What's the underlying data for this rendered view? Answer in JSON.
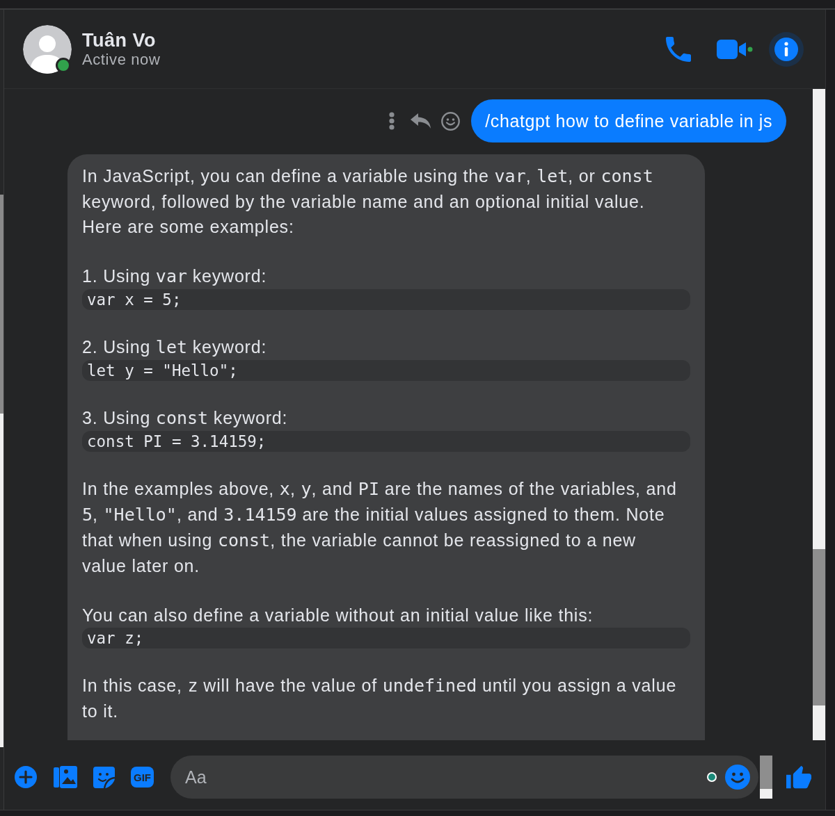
{
  "contact": {
    "name": "Tuân Vo",
    "status": "Active now",
    "online": true
  },
  "messages": [
    {
      "kind": "sent",
      "text": "/chatgpt how to define variable in js"
    },
    {
      "kind": "received",
      "blocks": [
        {
          "kind": "paragraph",
          "parts": [
            {
              "kind": "plain",
              "text": "In JavaScript, you can define a variable using the "
            },
            {
              "kind": "code",
              "text": "var"
            },
            {
              "kind": "plain",
              "text": ", "
            },
            {
              "kind": "code",
              "text": "let"
            },
            {
              "kind": "plain",
              "text": ", or "
            },
            {
              "kind": "code",
              "text": "const"
            },
            {
              "kind": "plain",
              "text": " keyword, followed by the variable name and an optional initial value. Here are some examples:"
            }
          ]
        },
        {
          "kind": "paragraph",
          "parts": [
            {
              "kind": "plain",
              "text": "1. Using "
            },
            {
              "kind": "code",
              "text": "var"
            },
            {
              "kind": "plain",
              "text": " keyword:"
            }
          ]
        },
        {
          "kind": "code_block",
          "text": "var x = 5;"
        },
        {
          "kind": "paragraph",
          "parts": [
            {
              "kind": "plain",
              "text": "2. Using "
            },
            {
              "kind": "code",
              "text": "let"
            },
            {
              "kind": "plain",
              "text": " keyword:"
            }
          ]
        },
        {
          "kind": "code_block",
          "text": "let y = \"Hello\";"
        },
        {
          "kind": "paragraph",
          "parts": [
            {
              "kind": "plain",
              "text": "3. Using "
            },
            {
              "kind": "code",
              "text": "const"
            },
            {
              "kind": "plain",
              "text": " keyword:"
            }
          ]
        },
        {
          "kind": "code_block",
          "text": "const PI = 3.14159;"
        },
        {
          "kind": "paragraph",
          "parts": [
            {
              "kind": "plain",
              "text": "In the examples above, "
            },
            {
              "kind": "code",
              "text": "x"
            },
            {
              "kind": "plain",
              "text": ", "
            },
            {
              "kind": "code",
              "text": "y"
            },
            {
              "kind": "plain",
              "text": ", and "
            },
            {
              "kind": "code",
              "text": "PI"
            },
            {
              "kind": "plain",
              "text": " are the names of the variables, and "
            },
            {
              "kind": "code",
              "text": "5"
            },
            {
              "kind": "plain",
              "text": ", "
            },
            {
              "kind": "code",
              "text": "\"Hello\""
            },
            {
              "kind": "plain",
              "text": ", and "
            },
            {
              "kind": "code",
              "text": "3.14159"
            },
            {
              "kind": "plain",
              "text": " are the initial values assigned to them. Note that when using "
            },
            {
              "kind": "code",
              "text": "const"
            },
            {
              "kind": "plain",
              "text": ", the variable cannot be reassigned to a new value later on."
            }
          ]
        },
        {
          "kind": "paragraph",
          "parts": [
            {
              "kind": "plain",
              "text": "You can also define a variable without an initial value like this:"
            }
          ]
        },
        {
          "kind": "code_block",
          "text": "var z;"
        },
        {
          "kind": "paragraph",
          "parts": [
            {
              "kind": "plain",
              "text": "In this case, "
            },
            {
              "kind": "code",
              "text": "z"
            },
            {
              "kind": "plain",
              "text": " will have the value of "
            },
            {
              "kind": "code",
              "text": "undefined"
            },
            {
              "kind": "plain",
              "text": " until you assign a value to it."
            }
          ]
        }
      ]
    }
  ],
  "composer": {
    "gif_label": "GIF",
    "placeholder": "Aa"
  }
}
